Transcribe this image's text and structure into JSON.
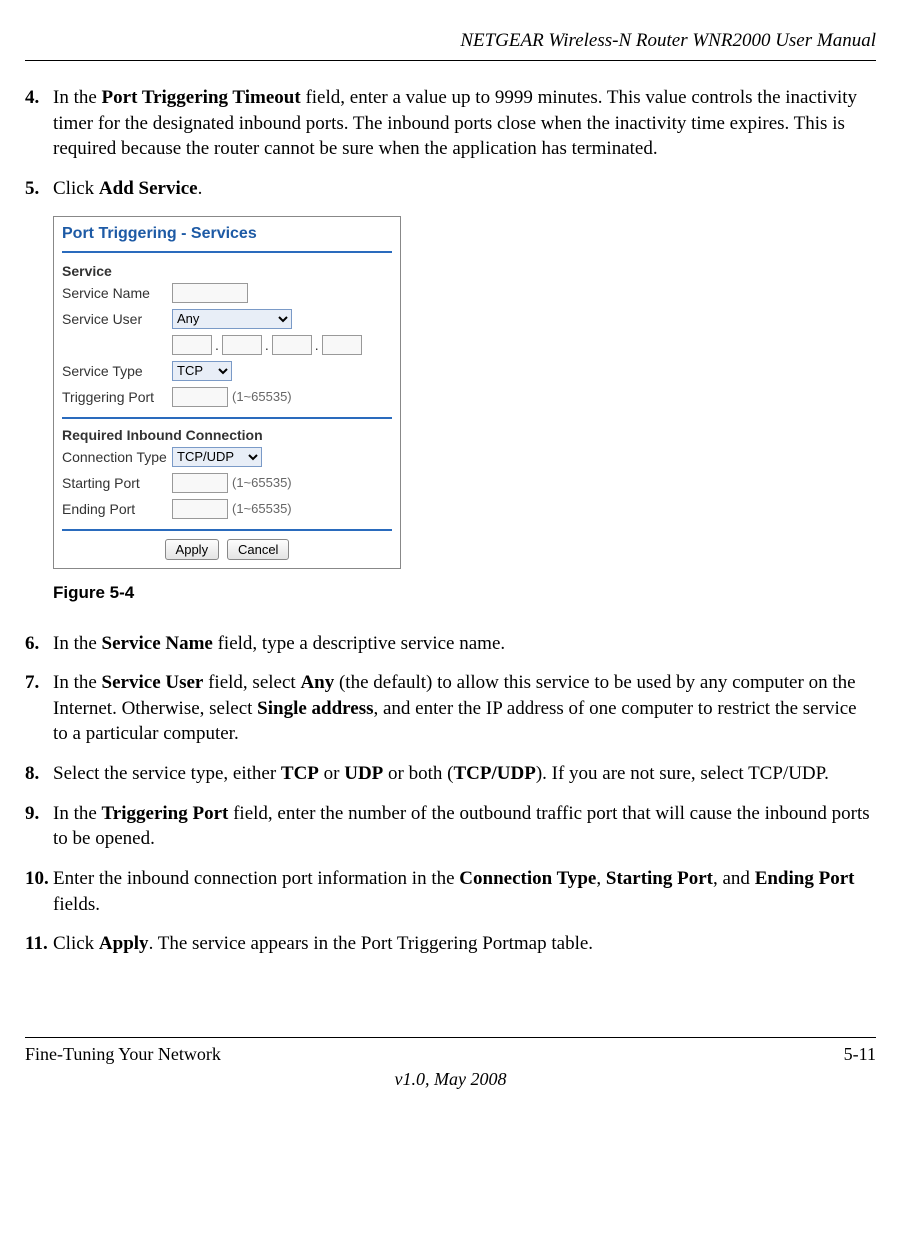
{
  "header": {
    "title": "NETGEAR Wireless-N Router WNR2000 User Manual"
  },
  "steps": {
    "s4": {
      "num": "4.",
      "pre": "In the ",
      "b1": "Port Triggering Timeout",
      "post": " field, enter a value up to 9999 minutes. This value controls the inactivity timer for the designated inbound ports. The inbound ports close when the inactivity time expires. This is required because the router cannot be sure when the application has terminated."
    },
    "s5": {
      "num": "5.",
      "pre": "Click ",
      "b1": "Add Service",
      "post": "."
    },
    "s6": {
      "num": "6.",
      "pre": "In the ",
      "b1": "Service Name",
      "post": " field, type a descriptive service name."
    },
    "s7": {
      "num": "7.",
      "pre": "In the ",
      "b1": "Service User",
      "mid1": " field, select ",
      "b2": "Any",
      "mid2": " (the default) to allow this service to be used by any computer on the Internet. Otherwise, select ",
      "b3": "Single address",
      "post": ", and enter the IP address of one computer to restrict the service to a particular computer."
    },
    "s8": {
      "num": "8.",
      "pre": "Select the service type, either ",
      "b1": "TCP",
      "mid1": " or ",
      "b2": "UDP",
      "mid2": " or both (",
      "b3": "TCP/UDP",
      "post": "). If you are not sure, select TCP/UDP."
    },
    "s9": {
      "num": "9.",
      "pre": "In the ",
      "b1": "Triggering Port",
      "post": " field, enter the number of the outbound traffic port that will cause the inbound ports to be opened."
    },
    "s10": {
      "num": "10.",
      "pre": "Enter the inbound connection port information in the ",
      "b1": "Connection Type",
      "mid1": ", ",
      "b2": "Starting Port",
      "mid2": ", and ",
      "b3": "Ending Port",
      "post": " fields."
    },
    "s11": {
      "num": "11.",
      "pre": "Click ",
      "b1": "Apply",
      "post": ". The service appears in the Port Triggering Portmap table."
    }
  },
  "figure": {
    "caption": "Figure 5-4",
    "title": "Port Triggering - Services",
    "section1": "Service",
    "labels": {
      "serviceName": "Service Name",
      "serviceUser": "Service User",
      "serviceType": "Service Type",
      "triggeringPort": "Triggering Port"
    },
    "section2": "Required Inbound Connection",
    "labels2": {
      "connectionType": "Connection Type",
      "startingPort": "Starting Port",
      "endingPort": "Ending Port"
    },
    "options": {
      "serviceUser": "Any",
      "serviceType": "TCP",
      "connectionType": "TCP/UDP"
    },
    "hint": "(1~65535)",
    "buttons": {
      "apply": "Apply",
      "cancel": "Cancel"
    }
  },
  "footer": {
    "left": "Fine-Tuning Your Network",
    "right": "5-11",
    "center": "v1.0, May 2008"
  }
}
